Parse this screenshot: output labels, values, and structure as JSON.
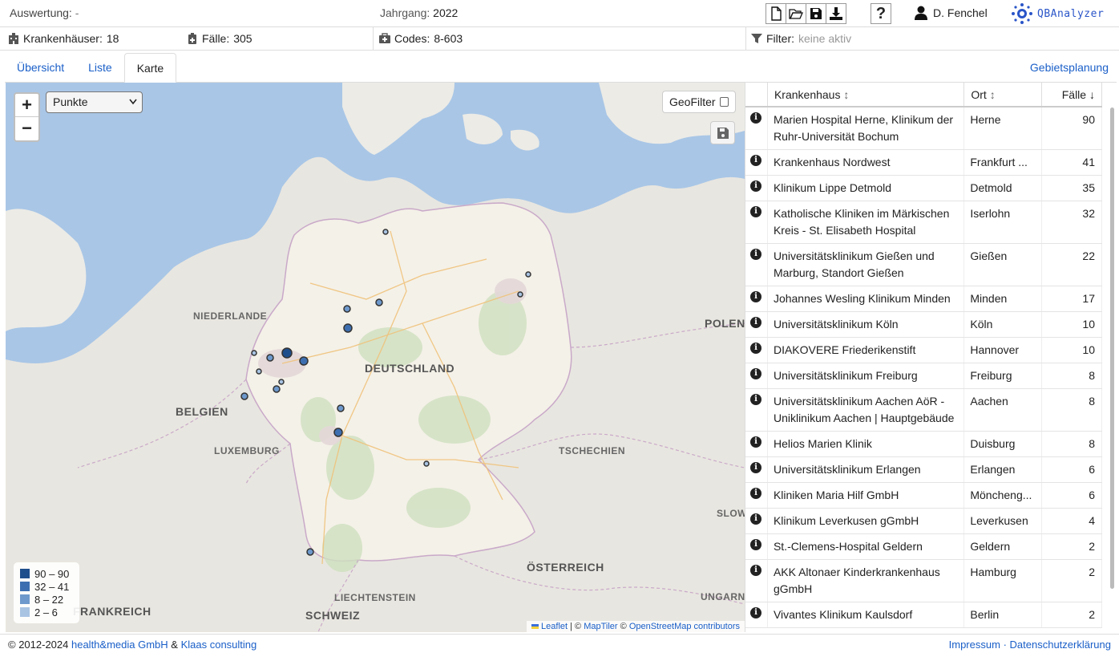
{
  "header": {
    "auswertung_label": "Auswertung:",
    "auswertung_value": "-",
    "jahrgang_label": "Jahrgang:",
    "jahrgang_value": "2022",
    "help_label": "?",
    "user_name": "D. Fenchel",
    "logo_text": "QBAnalyzer"
  },
  "stats": {
    "krankenhaeuser_label": "Krankenhäuser:",
    "krankenhaeuser_value": "18",
    "faelle_label": "Fälle:",
    "faelle_value": "305",
    "codes_label": "Codes:",
    "codes_value": "8-603",
    "filter_label": "Filter:",
    "filter_value": "keine aktiv"
  },
  "tabs": [
    {
      "label": "Übersicht",
      "active": false
    },
    {
      "label": "Liste",
      "active": false
    },
    {
      "label": "Karte",
      "active": true
    }
  ],
  "gebietsplanung": "Gebietsplanung",
  "map": {
    "zoom_in": "+",
    "zoom_out": "−",
    "mode_select": "Punkte",
    "geofilter_label": "GeoFilter",
    "labels": {
      "niederlande": "NIEDERLANDE",
      "belgien": "BELGIEN",
      "luxemburg": "LUXEMBURG",
      "deutschland": "DEUTSCHLAND",
      "polen": "POLEN",
      "tschechien": "TSCHECHIEN",
      "frankreich": "FRANKREICH",
      "schweiz": "SCHWEIZ",
      "liechtenstein": "LIECHTENSTEIN",
      "oesterreich": "ÖSTERREICH",
      "slowakei": "SLOW",
      "ungarn": "UNGARN"
    },
    "legend": [
      {
        "label": "90 – 90",
        "color": "#1f4e8c"
      },
      {
        "label": "32 – 41",
        "color": "#3d6fb0"
      },
      {
        "label": "8 – 22",
        "color": "#6e99cc"
      },
      {
        "label": "2 – 6",
        "color": "#a9c4e3"
      }
    ],
    "attribution": {
      "leaflet": "Leaflet",
      "sep": " | © ",
      "maptiler": "MapTiler",
      "sep2": " © ",
      "osm": "OpenStreetMap contributors"
    }
  },
  "table": {
    "headers": {
      "krankenhaus": "Krankenhaus",
      "ort": "Ort",
      "faelle": "Fälle"
    },
    "rows": [
      {
        "name": "Marien Hospital Herne, Klinikum der Ruhr-Universität Bochum",
        "ort": "Herne",
        "faelle": "90"
      },
      {
        "name": "Krankenhaus Nordwest",
        "ort": "Frankfurt ...",
        "faelle": "41"
      },
      {
        "name": "Klinikum Lippe Detmold",
        "ort": "Detmold",
        "faelle": "35"
      },
      {
        "name": "Katholische Kliniken im Märkischen Kreis - St. Elisabeth Hospital",
        "ort": "Iserlohn",
        "faelle": "32"
      },
      {
        "name": "Universitätsklinikum Gießen und Marburg, Standort Gießen",
        "ort": "Gießen",
        "faelle": "22"
      },
      {
        "name": "Johannes Wesling Klinikum Minden",
        "ort": "Minden",
        "faelle": "17"
      },
      {
        "name": "Universitätsklinikum Köln",
        "ort": "Köln",
        "faelle": "10"
      },
      {
        "name": "DIAKOVERE Friederikenstift",
        "ort": "Hannover",
        "faelle": "10"
      },
      {
        "name": "Universitätsklinikum Freiburg",
        "ort": "Freiburg",
        "faelle": "8"
      },
      {
        "name": "Universitätsklinikum Aachen AöR - Uniklinikum Aachen | Hauptgebäude",
        "ort": "Aachen",
        "faelle": "8"
      },
      {
        "name": "Helios Marien Klinik",
        "ort": "Duisburg",
        "faelle": "8"
      },
      {
        "name": "Universitätsklinikum Erlangen",
        "ort": "Erlangen",
        "faelle": "6"
      },
      {
        "name": "Kliniken Maria Hilf GmbH",
        "ort": "Möncheng...",
        "faelle": "6"
      },
      {
        "name": "Klinikum Leverkusen gGmbH",
        "ort": "Leverkusen",
        "faelle": "4"
      },
      {
        "name": "St.-Clemens-Hospital Geldern",
        "ort": "Geldern",
        "faelle": "2"
      },
      {
        "name": "AKK Altonaer Kinderkrankenhaus gGmbH",
        "ort": "Hamburg",
        "faelle": "2"
      },
      {
        "name": "Vivantes Klinikum Kaulsdorf",
        "ort": "Berlin",
        "faelle": "2"
      }
    ]
  },
  "footer": {
    "copyright": "© 2012-2024",
    "company1": "health&media GmbH",
    "amp": "&",
    "company2": "Klaas consulting",
    "impressum": "Impressum",
    "dot": "·",
    "datenschutz": "Datenschutzerklärung"
  }
}
